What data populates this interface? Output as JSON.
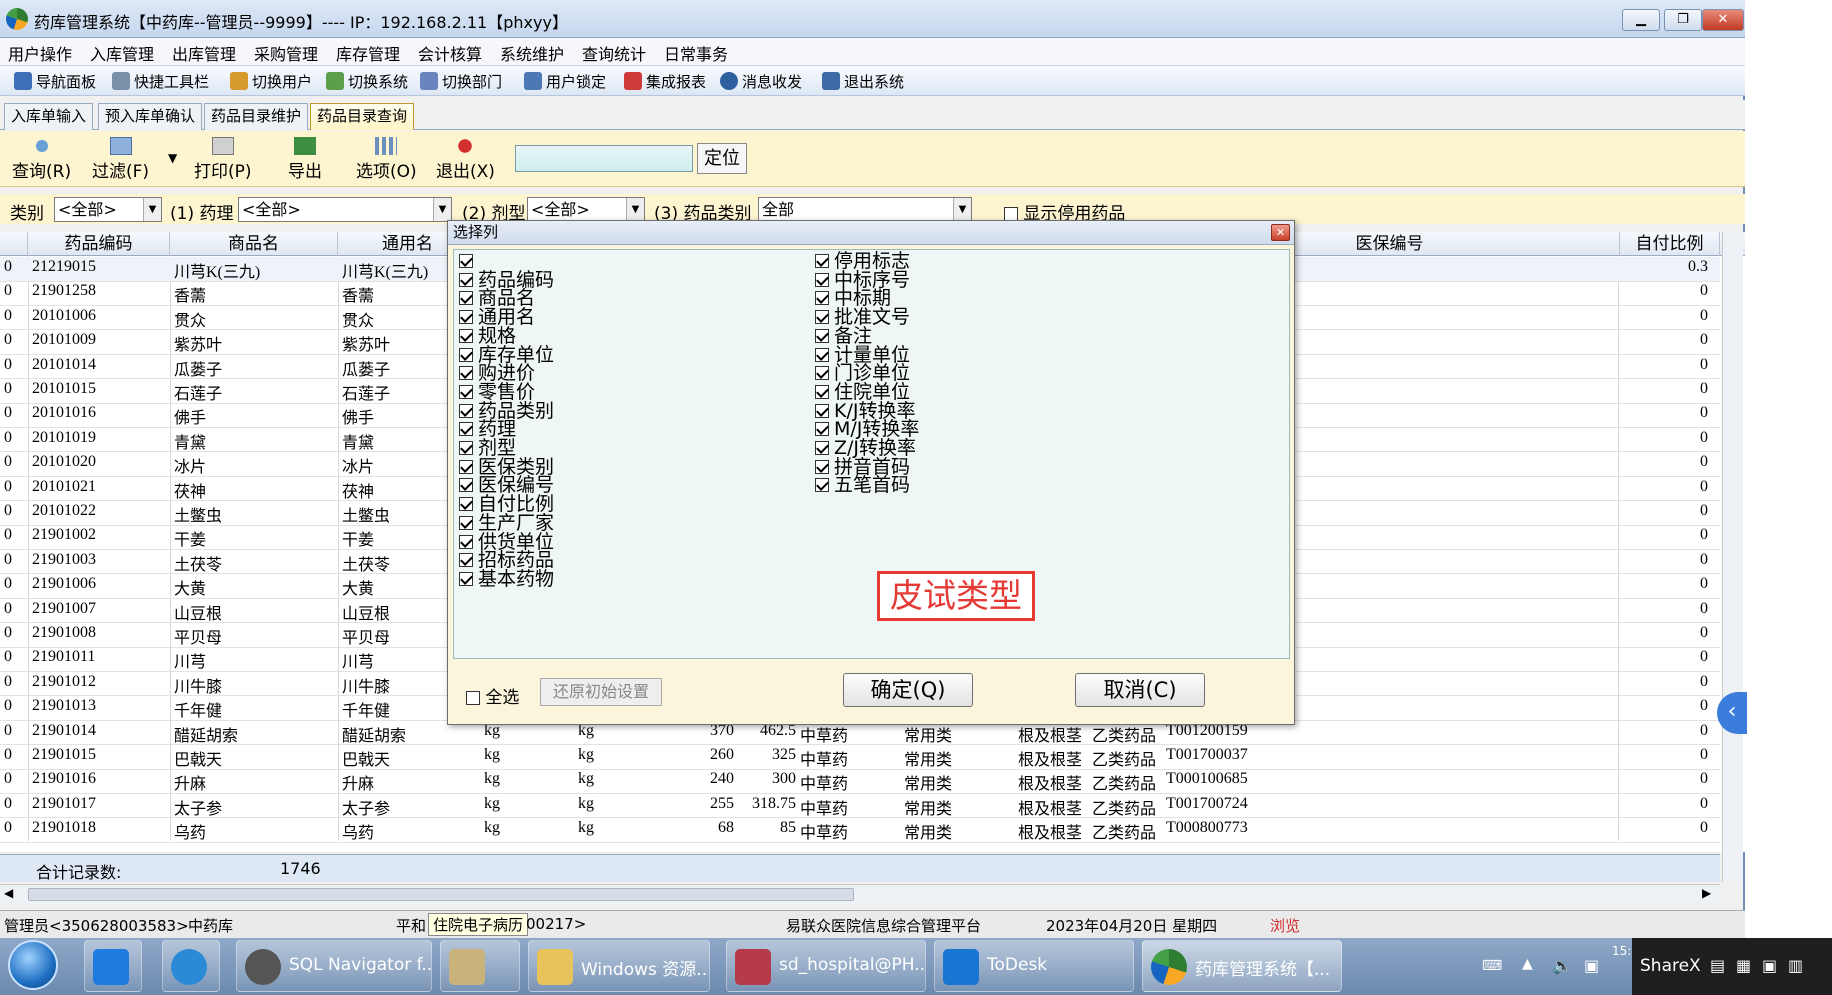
{
  "window": {
    "title": "药库管理系统【中药库--管理员--9999】---- IP：192.168.2.11【phxyy】"
  },
  "menu": [
    "用户操作",
    "入库管理",
    "出库管理",
    "采购管理",
    "库存管理",
    "会计核算",
    "系统维护",
    "查询统计",
    "日常事务"
  ],
  "toolbar": [
    "导航面板",
    "快捷工具栏",
    "切换用户",
    "切换系统",
    "切换部门",
    "用户锁定",
    "集成报表",
    "消息收发",
    "退出系统"
  ],
  "tabs": [
    "入库单输入",
    "预入库单确认",
    "药品目录维护",
    "药品目录查询"
  ],
  "query_toolbar": {
    "query": "查询(R)",
    "filter": "过滤(F)",
    "print": "打印(P)",
    "export": "导出",
    "options": "选项(O)",
    "exit": "退出(X)",
    "locate": "定位",
    "locate_value": ""
  },
  "filters": {
    "category_label": "类别",
    "category_value": "<全部>",
    "pharm_label": "(1) 药理",
    "pharm_value": "<全部>",
    "form_label": "(2) 剂型",
    "form_value": "<全部>",
    "drugcat_label": "(3) 药品类别",
    "drugcat_value": "全部",
    "show_disabled": "显示停用药品"
  },
  "grid": {
    "headers": {
      "code": "药品编码",
      "trade": "商品名",
      "generic": "通用名",
      "ins_code": "医保编号",
      "ratio": "自付比例"
    },
    "rows": [
      {
        "flag": "0",
        "code": "21219015",
        "trade": "川芎K(三九)",
        "generic": "川芎K(三九)",
        "ratio": "0.3"
      },
      {
        "flag": "0",
        "code": "21901258",
        "trade": "香薷",
        "generic": "香薷",
        "ratio": "0"
      },
      {
        "flag": "0",
        "code": "20101006",
        "trade": "贯众",
        "generic": "贯众",
        "ratio": "0"
      },
      {
        "flag": "0",
        "code": "20101009",
        "trade": "紫苏叶",
        "generic": "紫苏叶",
        "ratio": "0"
      },
      {
        "flag": "0",
        "code": "20101014",
        "trade": "瓜蒌子",
        "generic": "瓜蒌子",
        "ratio": "0"
      },
      {
        "flag": "0",
        "code": "20101015",
        "trade": "石莲子",
        "generic": "石莲子",
        "ratio": "0"
      },
      {
        "flag": "0",
        "code": "20101016",
        "trade": "佛手",
        "generic": "佛手",
        "ratio": "0"
      },
      {
        "flag": "0",
        "code": "20101019",
        "trade": "青黛",
        "generic": "青黛",
        "ratio": "0"
      },
      {
        "flag": "0",
        "code": "20101020",
        "trade": "冰片",
        "generic": "冰片",
        "ratio": "0"
      },
      {
        "flag": "0",
        "code": "20101021",
        "trade": "茯神",
        "generic": "茯神",
        "ratio": "0"
      },
      {
        "flag": "0",
        "code": "20101022",
        "trade": "土鳖虫",
        "generic": "土鳖虫",
        "ratio": "0"
      },
      {
        "flag": "0",
        "code": "21901002",
        "trade": "干姜",
        "generic": "干姜",
        "ratio": "0"
      },
      {
        "flag": "0",
        "code": "21901003",
        "trade": "土茯苓",
        "generic": "土茯苓",
        "ratio": "0"
      },
      {
        "flag": "0",
        "code": "21901006",
        "trade": "大黄",
        "generic": "大黄",
        "ratio": "0"
      },
      {
        "flag": "0",
        "code": "21901007",
        "trade": "山豆根",
        "generic": "山豆根",
        "ratio": "0"
      },
      {
        "flag": "0",
        "code": "21901008",
        "trade": "平贝母",
        "generic": "平贝母",
        "ratio": "0"
      },
      {
        "flag": "0",
        "code": "21901011",
        "trade": "川芎",
        "generic": "川芎",
        "ratio": "0"
      },
      {
        "flag": "0",
        "code": "21901012",
        "trade": "川牛膝",
        "generic": "川牛膝",
        "ratio": "0"
      },
      {
        "flag": "0",
        "code": "21901013",
        "trade": "千年健",
        "generic": "千年健",
        "ratio": "0"
      },
      {
        "flag": "0",
        "code": "21901014",
        "trade": "醋延胡索",
        "generic": "醋延胡索",
        "unit1": "kg",
        "unit2": "kg",
        "buy": "370",
        "sell": "462.5",
        "cat": "中草药",
        "type": "常用类",
        "pharm": "根及根茎",
        "ins": "乙类药品",
        "inscode": "T001200159",
        "ratio": "0"
      },
      {
        "flag": "0",
        "code": "21901015",
        "trade": "巴戟天",
        "generic": "巴戟天",
        "unit1": "kg",
        "unit2": "kg",
        "buy": "260",
        "sell": "325",
        "cat": "中草药",
        "type": "常用类",
        "pharm": "根及根茎",
        "ins": "乙类药品",
        "inscode": "T001700037",
        "ratio": "0"
      },
      {
        "flag": "0",
        "code": "21901016",
        "trade": "升麻",
        "generic": "升麻",
        "unit1": "kg",
        "unit2": "kg",
        "buy": "240",
        "sell": "300",
        "cat": "中草药",
        "type": "常用类",
        "pharm": "根及根茎",
        "ins": "乙类药品",
        "inscode": "T000100685",
        "ratio": "0"
      },
      {
        "flag": "0",
        "code": "21901017",
        "trade": "太子参",
        "generic": "太子参",
        "unit1": "kg",
        "unit2": "kg",
        "buy": "255",
        "sell": "318.75",
        "cat": "中草药",
        "type": "常用类",
        "pharm": "根及根茎",
        "ins": "乙类药品",
        "inscode": "T001700724",
        "ratio": "0"
      },
      {
        "flag": "0",
        "code": "21901018",
        "trade": "乌药",
        "generic": "乌药",
        "unit1": "kg",
        "unit2": "kg",
        "buy": "68",
        "sell": "85",
        "cat": "中草药",
        "type": "常用类",
        "pharm": "根及根茎",
        "ins": "乙类药品",
        "inscode": "T000800773",
        "ratio": "0"
      }
    ],
    "total_label": "合计记录数:",
    "total_value": "1746"
  },
  "dialog": {
    "title": "选择列",
    "left_items": [
      "",
      "药品编码",
      "商品名",
      "通用名",
      "规格",
      "库存单位",
      "购进价",
      "零售价",
      "药品类别",
      "药理",
      "剂型",
      "医保类别",
      "医保编号",
      "自付比例",
      "生产厂家",
      "供货单位",
      "招标药品",
      "基本药物"
    ],
    "right_items": [
      "停用标志",
      "中标序号",
      "中标期",
      "批准文号",
      "备注",
      "计量单位",
      "门诊单位",
      "住院单位",
      "K/J转换率",
      "M/J转换率",
      "Z/J转换率",
      "拼音首码",
      "五笔首码"
    ],
    "highlight": "皮试类型",
    "select_all": "全选",
    "restore": "还原初始设置",
    "ok": "确定(Q)",
    "cancel": "取消(C)"
  },
  "status": {
    "user": "管理员<350628003583>",
    "dept": "中药库",
    "s3": "平和",
    "tooltip": "住院电子病历",
    "s4": "00217>",
    "platform": "易联众医院信息综合管理平台",
    "date": "2023年04月20日 星期四",
    "browse": "浏览"
  },
  "taskbar": {
    "items": [
      "SQL Navigator f...",
      "Windows 资源...",
      "sd_hospital@PH...",
      "ToDesk",
      "药库管理系统【..."
    ],
    "sharex": "ShareX",
    "clock": "15:22"
  }
}
